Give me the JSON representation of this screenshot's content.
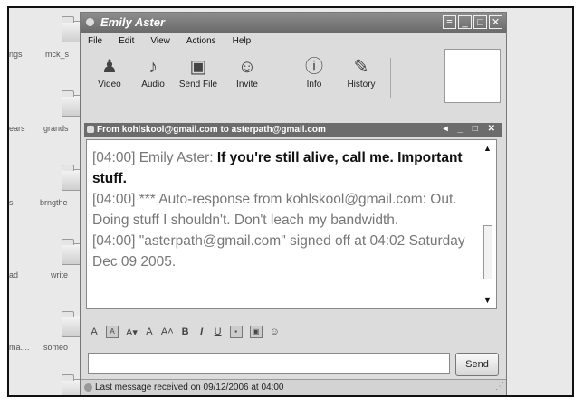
{
  "window": {
    "title": "Emily Aster",
    "menu": [
      "File",
      "Edit",
      "View",
      "Actions",
      "Help"
    ],
    "toolbar": [
      {
        "label": "Video",
        "icon": "video-icon",
        "glyph": "♟"
      },
      {
        "label": "Audio",
        "icon": "audio-icon",
        "glyph": "♪"
      },
      {
        "label": "Send File",
        "icon": "send-file-icon",
        "glyph": "▣"
      },
      {
        "label": "Invite",
        "icon": "invite-icon",
        "glyph": "☺"
      },
      {
        "label": "Info",
        "icon": "info-icon",
        "glyph": "ⓘ"
      },
      {
        "label": "History",
        "icon": "history-icon",
        "glyph": "✎"
      }
    ]
  },
  "conversation": {
    "header": "From kohlskool@gmail.com to asterpath@gmail.com",
    "messages": [
      {
        "time": "[04:00]",
        "sender": "Emily Aster:",
        "text": "If you're still alive, call me. Important stuff."
      },
      {
        "time": "[04:00]",
        "text": "*** Auto-response from kohlskool@gmail.com: Out. Doing stuff I shouldn't. Don't leach my bandwidth."
      },
      {
        "time": "[04:00]",
        "text": "\"asterpath@gmail.com\" signed off at 04:02 Saturday Dec 09 2005."
      }
    ]
  },
  "format_bar": [
    "A",
    "A",
    "A▾",
    "A",
    "A˄",
    "B",
    "I",
    "U"
  ],
  "send_label": "Send",
  "status_text": "Last message received on 09/12/2006 at 04:00",
  "desktop": {
    "labels": [
      "ngs",
      "mck_s",
      "ears",
      "grands",
      "s",
      "brngthe",
      "ad",
      "write",
      "ma....",
      "someo"
    ]
  }
}
